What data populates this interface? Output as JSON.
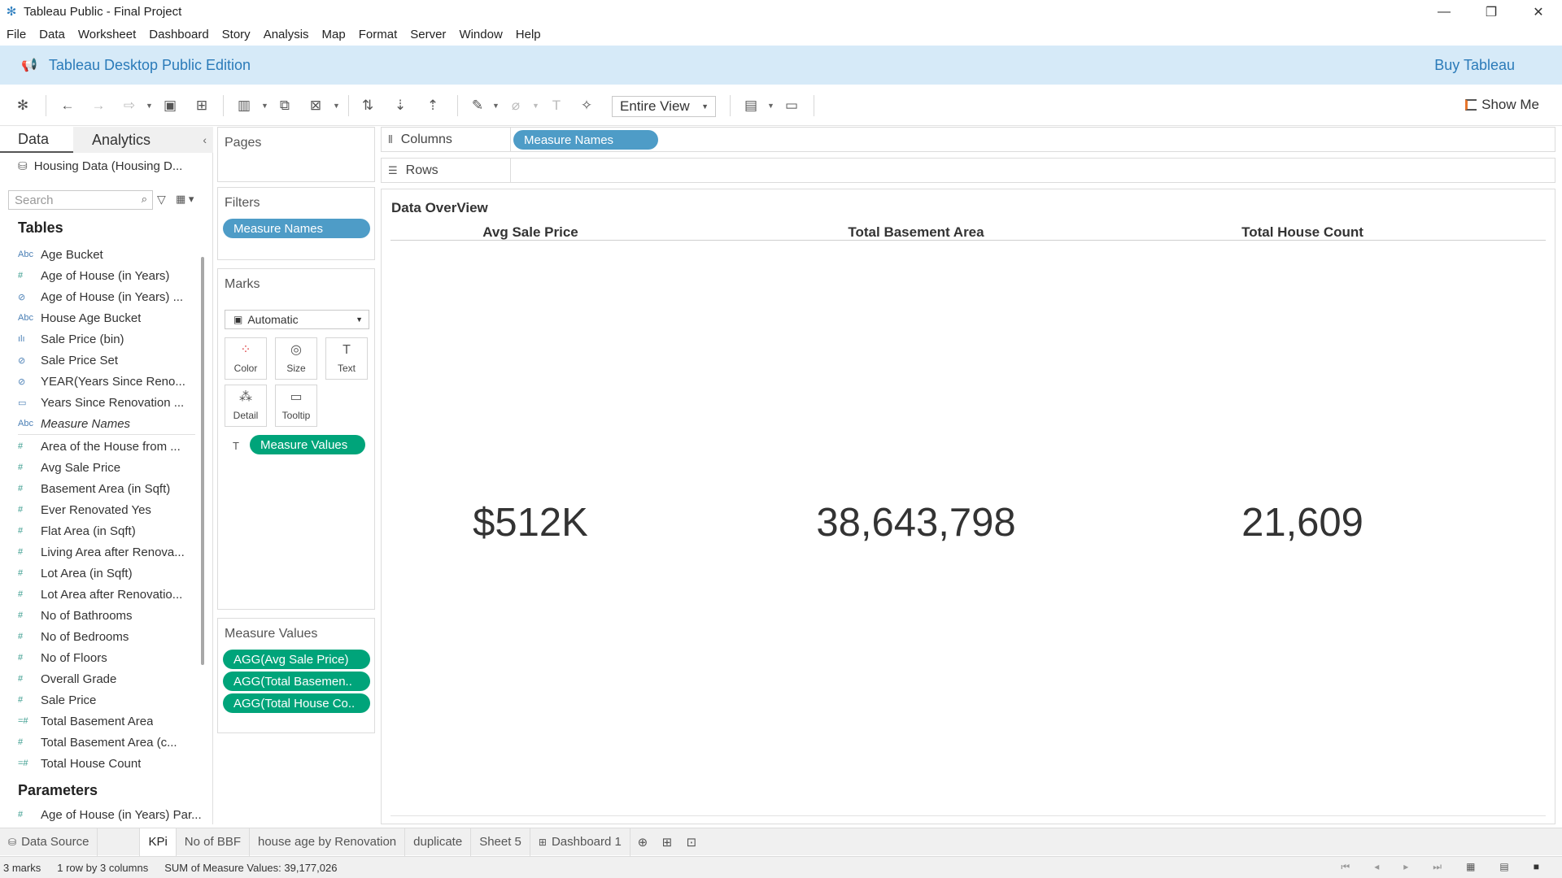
{
  "window": {
    "title": "Tableau Public - Final Project",
    "minimize": "—",
    "maximize": "❐",
    "close": "✕"
  },
  "menu": [
    "File",
    "Data",
    "Worksheet",
    "Dashboard",
    "Story",
    "Analysis",
    "Map",
    "Format",
    "Server",
    "Window",
    "Help"
  ],
  "banner": {
    "edition": "Tableau Desktop Public Edition",
    "buy": "Buy Tableau"
  },
  "toolbar": {
    "fit": "Entire View",
    "show_me": "Show Me"
  },
  "data_pane": {
    "tab_data": "Data",
    "tab_analytics": "Analytics",
    "datasource": "Housing Data (Housing D...",
    "search_placeholder": "Search",
    "tables_title": "Tables",
    "parameters_title": "Parameters",
    "dimensions": [
      {
        "type": "Abc",
        "name": "Age Bucket"
      },
      {
        "type": "#",
        "name": "Age of House (in Years)"
      },
      {
        "type": "⊘",
        "name": "Age of House (in Years) ..."
      },
      {
        "type": "Abc",
        "name": "House Age Bucket"
      },
      {
        "type": "ılı",
        "name": "Sale Price (bin)"
      },
      {
        "type": "⊘",
        "name": "Sale Price Set"
      },
      {
        "type": "⊘",
        "name": "YEAR(Years Since Reno..."
      },
      {
        "type": "▭",
        "name": "Years Since Renovation ..."
      },
      {
        "type": "Abc",
        "name": "Measure Names"
      }
    ],
    "measures": [
      {
        "type": "#",
        "name": "Area of the House from ..."
      },
      {
        "type": "#",
        "name": "Avg Sale Price"
      },
      {
        "type": "#",
        "name": "Basement Area (in Sqft)"
      },
      {
        "type": "#",
        "name": "Ever Renovated Yes"
      },
      {
        "type": "#",
        "name": "Flat Area (in Sqft)"
      },
      {
        "type": "#",
        "name": "Living Area after Renova..."
      },
      {
        "type": "#",
        "name": "Lot Area (in Sqft)"
      },
      {
        "type": "#",
        "name": "Lot Area after Renovatio..."
      },
      {
        "type": "#",
        "name": "No of Bathrooms"
      },
      {
        "type": "#",
        "name": "No of Bedrooms"
      },
      {
        "type": "#",
        "name": "No of Floors"
      },
      {
        "type": "#",
        "name": "Overall Grade"
      },
      {
        "type": "#",
        "name": "Sale Price"
      },
      {
        "type": "=#",
        "name": "Total Basement Area"
      },
      {
        "type": "#",
        "name": "Total Basement Area (c..."
      },
      {
        "type": "=#",
        "name": "Total House Count"
      }
    ],
    "parameters": [
      {
        "type": "#",
        "name": "Age of House (in Years) Par..."
      }
    ]
  },
  "cards": {
    "pages": "Pages",
    "filters": "Filters",
    "filter_pill": "Measure Names",
    "marks": "Marks",
    "mark_type": "Automatic",
    "mark_buttons": [
      "Color",
      "Size",
      "Text",
      "Detail",
      "Tooltip"
    ],
    "marks_pill": "Measure Values",
    "measure_values_title": "Measure Values",
    "measure_values_pills": [
      "AGG(Avg Sale Price)",
      "AGG(Total Basemen..",
      "AGG(Total House Co.."
    ]
  },
  "shelves": {
    "columns_label": "Columns",
    "columns_pill": "Measure Names",
    "rows_label": "Rows"
  },
  "viz": {
    "title": "Data OverView",
    "headers": [
      "Avg Sale Price",
      "Total Basement Area",
      "Total House Count"
    ],
    "values": [
      "$512K",
      "38,643,798",
      "21,609"
    ]
  },
  "sheet_tabs": {
    "data_source": "Data Source",
    "sheets": [
      "KPi",
      "No of BBF",
      "house age by Renovation",
      "duplicate",
      "Sheet 5",
      "Dashboard 1"
    ]
  },
  "status": {
    "marks": "3 marks",
    "dims": "1 row by 3 columns",
    "sum": "SUM of Measure Values: 39,177,026"
  }
}
